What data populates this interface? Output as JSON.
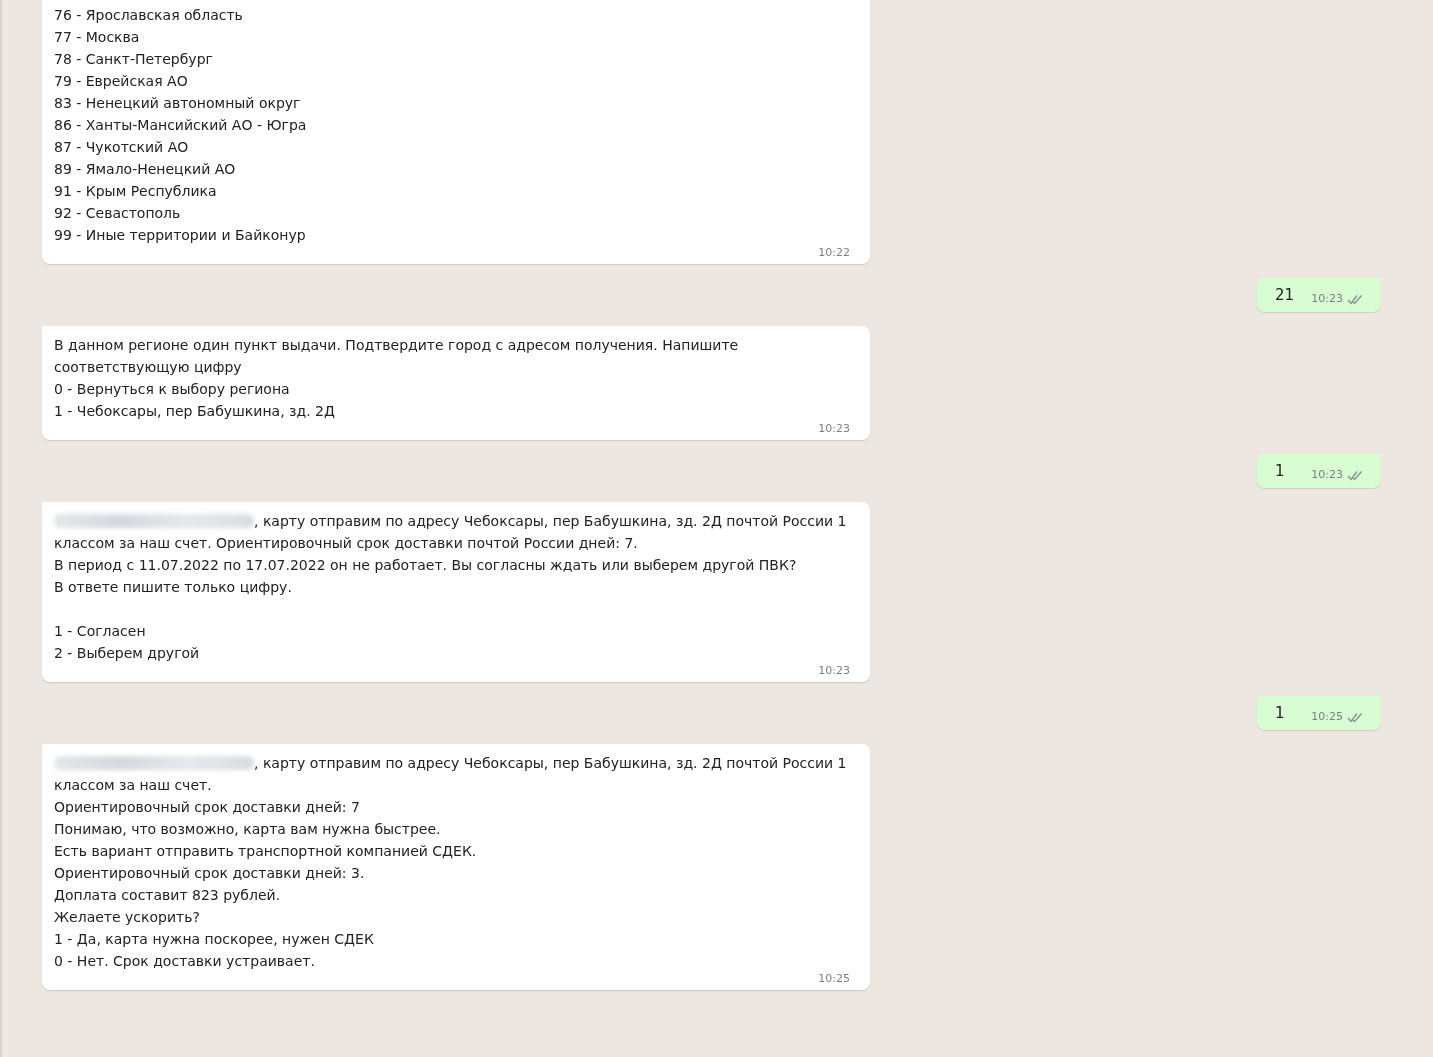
{
  "messages": [
    {
      "kind": "incoming",
      "redacted_name": false,
      "paragraphs": [
        [
          "76 - Ярославская область",
          "77 - Москва",
          "78 - Санкт-Петербург",
          "79 - Еврейская АО",
          "83 - Ненецкий автономный округ",
          "86 - Ханты-Мансийский АО - Югра",
          "87 - Чукотский АО",
          "89 - Ямало-Ненецкий АО",
          "91 - Крым Республика",
          "92 - Севастополь",
          "99 - Иные территории и Байконур"
        ]
      ],
      "time": "10:22"
    },
    {
      "kind": "outgoing",
      "paragraphs": [
        [
          "21"
        ]
      ],
      "time": "10:23"
    },
    {
      "kind": "incoming",
      "redacted_name": false,
      "paragraphs": [
        [
          "В данном регионе один пункт выдачи. Подтвердите  город с адресом получения. Напишите",
          "соответствующую цифру",
          "0 - Вернуться к выбору региона",
          "1 - Чебоксары, пер Бабушкина, зд. 2Д"
        ]
      ],
      "time": "10:23"
    },
    {
      "kind": "outgoing",
      "paragraphs": [
        [
          "1"
        ]
      ],
      "time": "10:23"
    },
    {
      "kind": "incoming",
      "redacted_name": true,
      "paragraphs": [
        [
          ", карту отправим по адресу Чебоксары, пер Бабушкина, зд. 2Д почтой России 1",
          "классом за наш счет. Ориентировочный срок доставки почтой России дней: 7.",
          "В период с 11.07.2022 по 17.07.2022 он не работает. Вы согласны ждать или выберем другой ПВК?",
          "В ответе пишите только цифру."
        ],
        [
          "1 - Согласен",
          "2 - Выберем другой"
        ]
      ],
      "time": "10:23"
    },
    {
      "kind": "outgoing",
      "paragraphs": [
        [
          "1"
        ]
      ],
      "time": "10:25"
    },
    {
      "kind": "incoming",
      "redacted_name": true,
      "paragraphs": [
        [
          ", карту отправим по адресу Чебоксары, пер Бабушкина, зд. 2Д почтой России 1",
          "классом за наш счет.",
          "Ориентировочный срок доставки дней: 7",
          "Понимаю, что возможно, карта вам нужна быстрее.",
          "Есть вариант отправить транспортной компанией СДЕК.",
          "Ориентировочный срок доставки дней: 3.",
          "Доплата составит 823 рублей.",
          "Желаете ускорить?",
          "1 - Да, карта нужна поскорее, нужен СДЕК",
          "0 - Нет. Срок доставки устраивает."
        ]
      ],
      "time": "10:25"
    }
  ]
}
